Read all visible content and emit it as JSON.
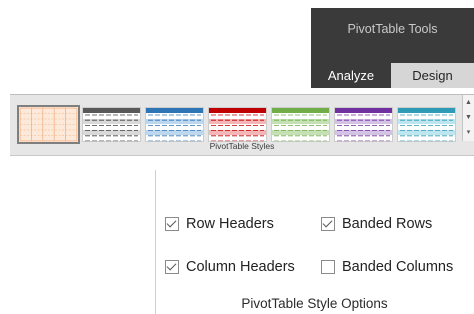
{
  "ribbon": {
    "context_title": "PivotTable Tools",
    "tabs": [
      {
        "label": "Analyze"
      },
      {
        "label": "Design"
      }
    ]
  },
  "styles_gallery": {
    "label": "PivotTable Styles",
    "swatches": [
      {
        "name": "orange-light",
        "header": "#f4b183",
        "band": "#f8cbad",
        "line": "#f4b183",
        "selected": true
      },
      {
        "name": "gray-medium",
        "header": "#595959",
        "band": "#d9d9d9",
        "line": "#404040",
        "selected": false
      },
      {
        "name": "blue-medium",
        "header": "#2e75b6",
        "band": "#bdd7ee",
        "line": "#2e75b6",
        "selected": false
      },
      {
        "name": "red-medium",
        "header": "#c00000",
        "band": "#f4b6b6",
        "line": "#c00000",
        "selected": false
      },
      {
        "name": "green-medium",
        "header": "#70ad47",
        "band": "#c5e0b4",
        "line": "#70ad47",
        "selected": false
      },
      {
        "name": "purple-medium",
        "header": "#7030a0",
        "band": "#d5c3e6",
        "line": "#7030a0",
        "selected": false
      },
      {
        "name": "teal-medium",
        "header": "#2e9bb6",
        "band": "#bde6ee",
        "line": "#2e9bb6",
        "selected": false
      }
    ]
  },
  "style_options": {
    "label": "PivotTable Style Options",
    "row_headers": {
      "label": "Row Headers",
      "checked": true
    },
    "banded_rows": {
      "label": "Banded Rows",
      "checked": true
    },
    "column_headers": {
      "label": "Column Headers",
      "checked": true
    },
    "banded_columns": {
      "label": "Banded Columns",
      "checked": false
    }
  }
}
